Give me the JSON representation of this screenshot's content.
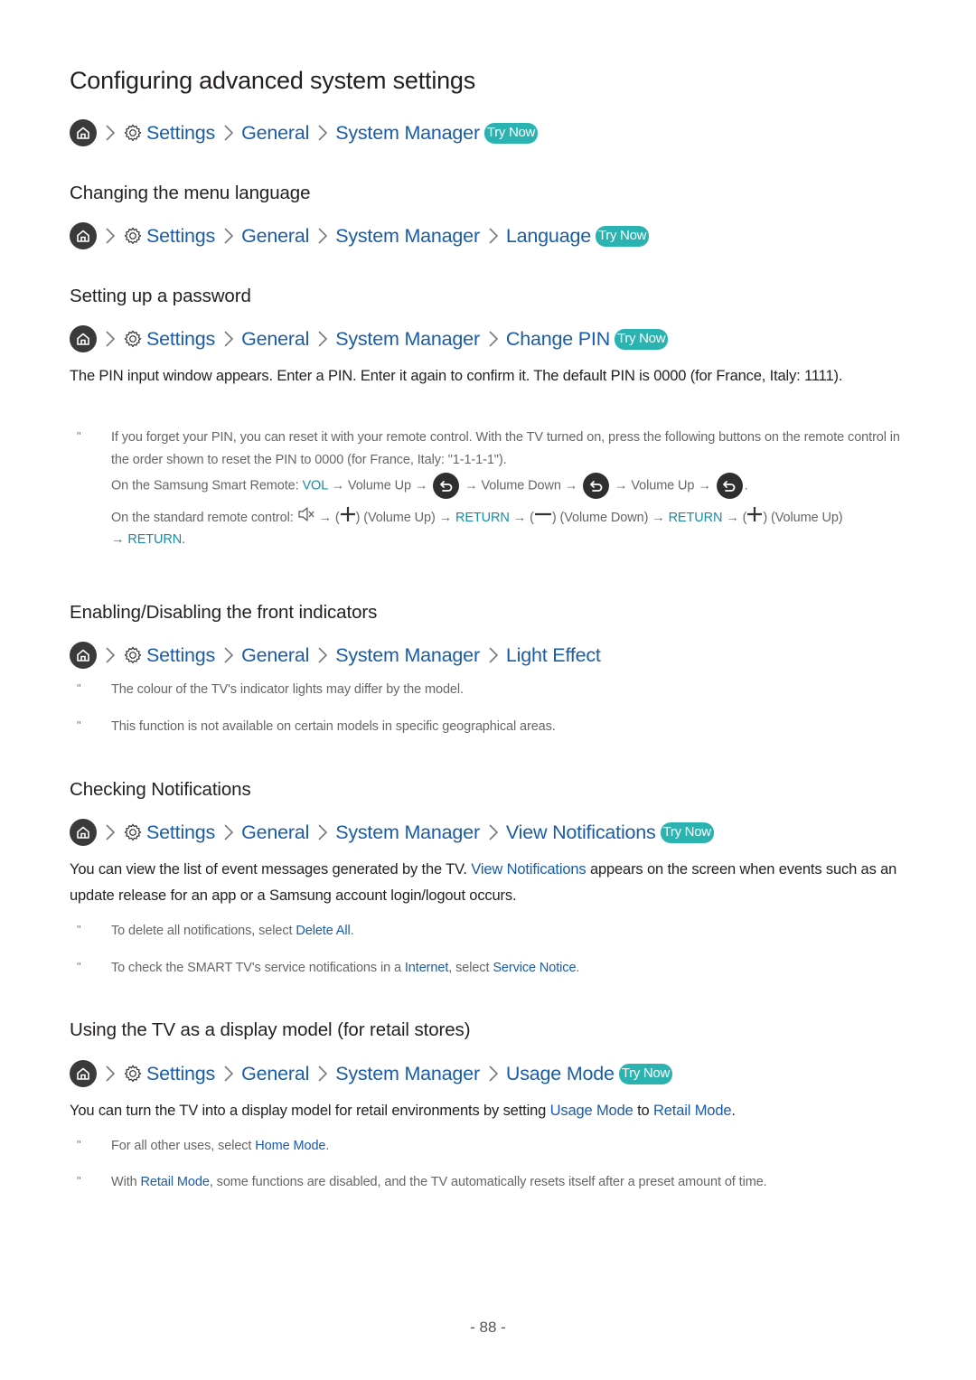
{
  "page": {
    "title": "Configuring advanced system settings",
    "page_number": "- 88 -"
  },
  "colors": {
    "link_blue": "#1a5ca8",
    "teal_badge": "#2bb3b1",
    "teal_text": "#168ba6",
    "home_icon_bg": "#3a3a3a"
  },
  "icons": {
    "home": "home-icon",
    "gear": "settings-gear-icon",
    "chevron": "chevron-right-icon",
    "return": "return-button-icon",
    "mute": "mute-icon",
    "plus": "plus-icon",
    "minus": "minus-icon"
  },
  "common": {
    "settings": "Settings",
    "general": "General",
    "system_manager": "System Manager",
    "try_now": "Try Now",
    "note_mark": "\""
  },
  "sections": {
    "main": {
      "path": [
        "Settings",
        "General",
        "System Manager"
      ],
      "try_now": true
    },
    "language": {
      "heading": "Changing the menu language",
      "last": "Language",
      "try_now": true
    },
    "password": {
      "heading": "Setting up a password",
      "last": "Change PIN",
      "try_now": true,
      "body": "The PIN input window appears. Enter a PIN. Enter it again to confirm it. The default PIN is 0000 (for France, Italy: 1111).",
      "note_line1": "If you forget your PIN, you can reset it with your remote control. With the TV turned on, press the following buttons on the remote control in the order shown to reset the PIN to 0000 (for France, Italy: \"1-1-1-1\").",
      "smart_remote": {
        "prefix": "On the Samsung Smart Remote: ",
        "vol": "VOL",
        "step1": " → Volume Up → ",
        "step2": " → Volume Down → ",
        "step3": " → Volume Up → ",
        "end": "."
      },
      "standard_remote": {
        "prefix": "On the standard remote control: ",
        "arrow": " → ",
        "open": "(",
        "close": ")",
        "volume_up": " (Volume Up)",
        "volume_down": " (Volume Down)",
        "return": "RETURN",
        "end": "."
      }
    },
    "light": {
      "heading": "Enabling/Disabling the front indicators",
      "last": "Light Effect",
      "try_now": false,
      "notes": [
        "The colour of the TV's indicator lights may differ by the model.",
        "This function is not available on certain models in specific geographical areas."
      ]
    },
    "notifications": {
      "heading": "Checking Notifications",
      "last": "View Notifications",
      "try_now": true,
      "body_pre": "You can view the list of event messages generated by the TV. ",
      "body_link": "View Notifications",
      "body_post": " appears on the screen when events such as an update release for an app or a Samsung account login/logout occurs.",
      "note1_pre": "To delete all notifications, select ",
      "note1_link": "Delete All",
      "note1_post": ".",
      "note2_pre": "To check the SMART TV's service notifications in a ",
      "note2_link1": "Internet",
      "note2_mid": ", select ",
      "note2_link2": "Service Notice",
      "note2_post": "."
    },
    "retail": {
      "heading": "Using the TV as a display model (for retail stores)",
      "last": "Usage Mode",
      "try_now": true,
      "body_pre": "You can turn the TV into a display model for retail environments by setting ",
      "body_link1": "Usage Mode",
      "body_mid": " to ",
      "body_link2": "Retail Mode",
      "body_post": ".",
      "note1_pre": "For all other uses, select ",
      "note1_link": "Home Mode",
      "note1_post": ".",
      "note2_pre": "With ",
      "note2_link": "Retail Mode",
      "note2_post": ", some functions are disabled, and the TV automatically resets itself after a preset amount of time."
    }
  }
}
